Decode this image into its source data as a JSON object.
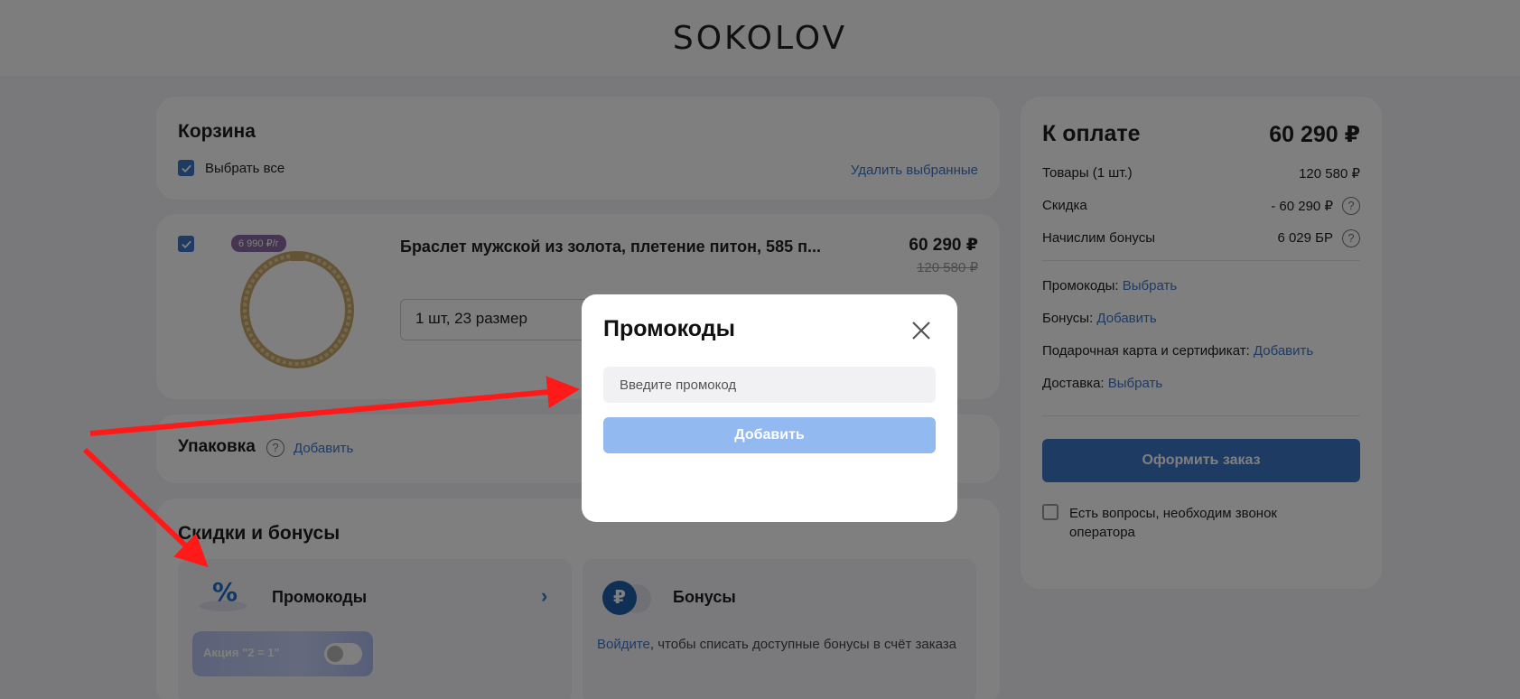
{
  "header": {
    "logo": "SOKOLOV"
  },
  "cart": {
    "title": "Корзина",
    "select_all_label": "Выбрать все",
    "delete_selected_label": "Удалить выбранные"
  },
  "item": {
    "badge": "6 990 ₽/г",
    "title": "Браслет мужской из золота, плетение питон, 585 п...",
    "price": "60 290 ₽",
    "old_price": "120 580 ₽",
    "size_select_value": "1 шт, 23 размер"
  },
  "packaging": {
    "title": "Упаковка",
    "help": "?",
    "add_label": "Добавить"
  },
  "discounts": {
    "title": "Скидки и бонусы",
    "promo_tile": {
      "title": "Промокоды",
      "chevron": "›",
      "promo_pill_label": "Акция \"2 = 1\"",
      "toggle_on": false
    },
    "bonus_tile": {
      "icon_symbol": "₽",
      "title": "Бонусы",
      "login_link": "Войдите",
      "description": ", чтобы списать доступные бонусы в счёт заказа"
    }
  },
  "summary": {
    "title": "К оплате",
    "total": "60 290 ₽",
    "rows": [
      {
        "label": "Товары (1 шт.)",
        "value": "120 580 ₽"
      },
      {
        "label": "Скидка",
        "value": "- 60 290 ₽"
      },
      {
        "label": "Начислим бонусы",
        "value": "6 029 БР"
      }
    ],
    "help": "?",
    "actions": [
      {
        "label": "Промокоды:",
        "link": "Выбрать"
      },
      {
        "label": "Бонусы:",
        "link": "Добавить"
      },
      {
        "label": "Подарочная карта и сертификат:",
        "link": "Добавить"
      },
      {
        "label": "Доставка:",
        "link": "Выбрать"
      }
    ],
    "checkout_label": "Оформить заказ",
    "call_request_label": "Есть вопросы, необходим звонок оператора"
  },
  "modal": {
    "title": "Промокоды",
    "input_placeholder": "Введите промокод",
    "add_button_label": "Добавить"
  },
  "colors": {
    "accent": "#3d76c8",
    "accent_disabled": "#93b9f1",
    "annotation_arrow": "#ff1a1a"
  }
}
